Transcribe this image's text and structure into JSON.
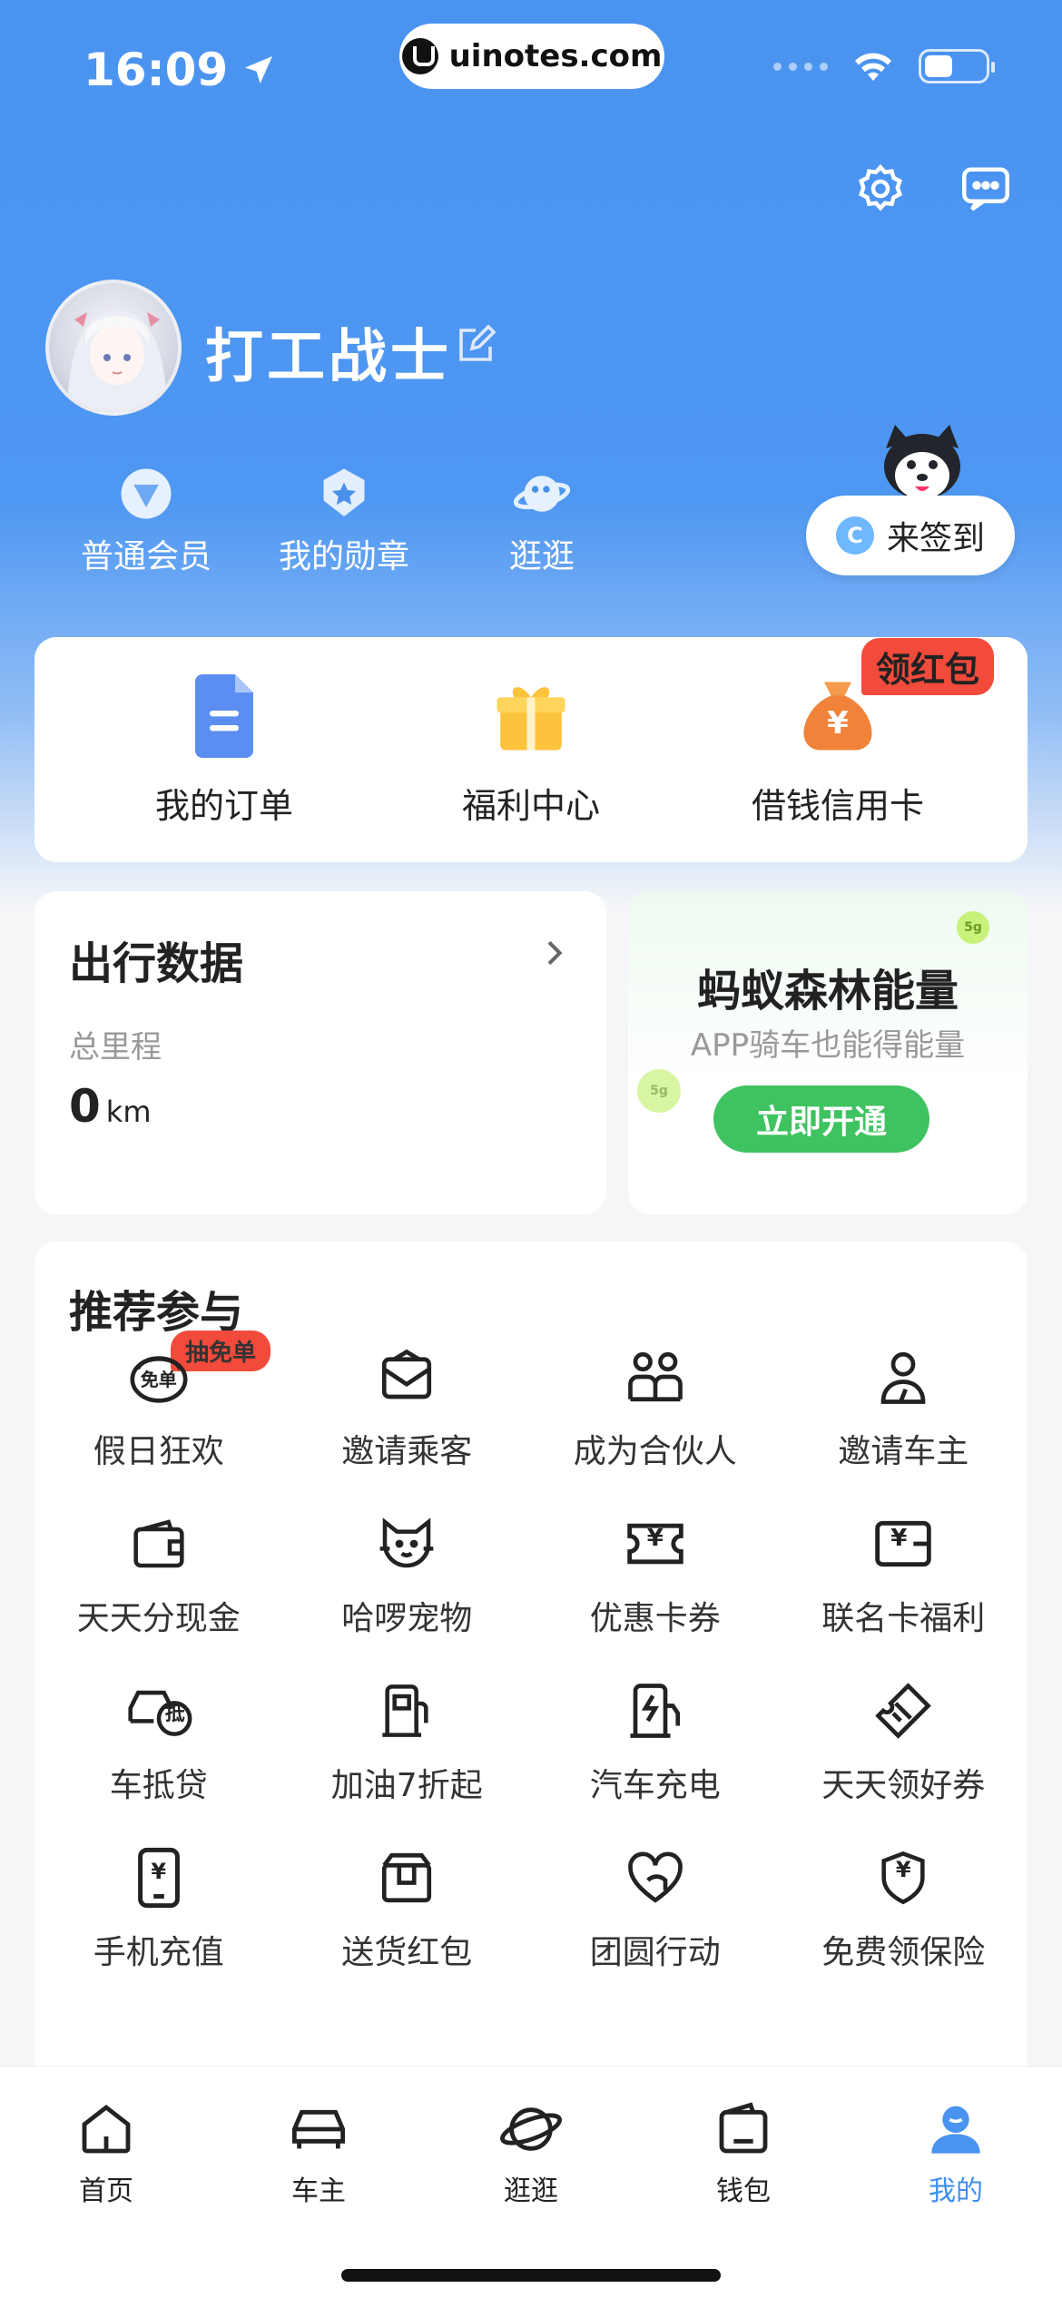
{
  "status_bar": {
    "time": "16:09",
    "url": "uinotes.com"
  },
  "profile": {
    "username": "打工战士"
  },
  "badges": [
    {
      "label": "普通会员",
      "icon": "member-icon"
    },
    {
      "label": "我的勋章",
      "icon": "medal-icon"
    },
    {
      "label": "逛逛",
      "icon": "planet-icon"
    }
  ],
  "checkin": {
    "label": "来签到",
    "coin": "C"
  },
  "quick": [
    {
      "label": "我的订单",
      "icon": "order-icon"
    },
    {
      "label": "福利中心",
      "icon": "gift-icon"
    },
    {
      "label": "借钱信用卡",
      "icon": "money-bag-icon",
      "tag": "领红包",
      "symbol": "¥"
    }
  ],
  "travel": {
    "title": "出行数据",
    "subtitle": "总里程",
    "value": "0",
    "unit": "km"
  },
  "ant_forest": {
    "title": "蚂蚁森林能量",
    "subtitle": "APP骑车也能得能量",
    "button": "立即开通",
    "coin_label": "5g"
  },
  "recommend": {
    "title": "推荐参与",
    "items": [
      {
        "label": "假日狂欢",
        "icon": "free-order-icon",
        "tag": "抽免单",
        "icon_text": "免单"
      },
      {
        "label": "邀请乘客",
        "icon": "envelope-icon"
      },
      {
        "label": "成为合伙人",
        "icon": "partners-icon"
      },
      {
        "label": "邀请车主",
        "icon": "driver-icon"
      },
      {
        "label": "天天分现金",
        "icon": "wallet-icon"
      },
      {
        "label": "哈啰宠物",
        "icon": "cat-icon"
      },
      {
        "label": "优惠卡券",
        "icon": "ticket-icon",
        "icon_text": "¥"
      },
      {
        "label": "联名卡福利",
        "icon": "card-icon",
        "icon_text": "¥"
      },
      {
        "label": "车抵贷",
        "icon": "car-loan-icon",
        "icon_text": "抵"
      },
      {
        "label": "加油7折起",
        "icon": "fuel-icon"
      },
      {
        "label": "汽车充电",
        "icon": "charging-icon"
      },
      {
        "label": "天天领好券",
        "icon": "coupon-icon"
      },
      {
        "label": "手机充值",
        "icon": "phone-topup-icon",
        "icon_text": "¥"
      },
      {
        "label": "送货红包",
        "icon": "package-icon"
      },
      {
        "label": "团圆行动",
        "icon": "heart-hands-icon"
      },
      {
        "label": "免费领保险",
        "icon": "insurance-icon",
        "icon_text": "¥"
      }
    ]
  },
  "tabbar": [
    {
      "label": "首页",
      "icon": "home-icon",
      "active": false
    },
    {
      "label": "车主",
      "icon": "car-icon",
      "active": false
    },
    {
      "label": "逛逛",
      "icon": "planet-icon",
      "active": false
    },
    {
      "label": "钱包",
      "icon": "wallet-icon",
      "active": false
    },
    {
      "label": "我的",
      "icon": "profile-icon",
      "active": true
    }
  ],
  "colors": {
    "primary_blue": "#4a93f0",
    "active_tab": "#3d8ff0",
    "green_button": "#3fc260",
    "red_tag": "#f24a3b"
  }
}
